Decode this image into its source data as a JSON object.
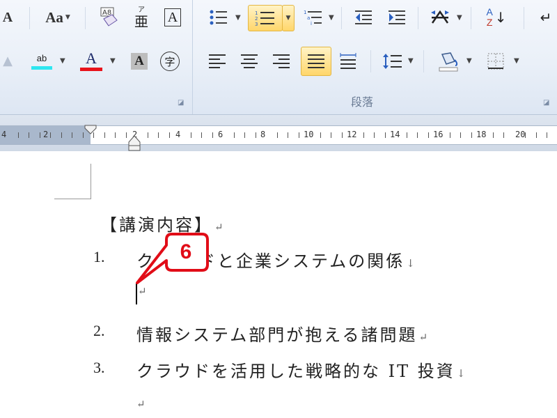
{
  "ribbon": {
    "font": {
      "font_size_label": "A",
      "change_case_label": "Aa",
      "clear_format_label": "Aₐ",
      "phonetic_top": "ア",
      "phonetic_bottom": "亜",
      "char_border_label": "A",
      "font_color_label": "A",
      "char_shading_label": "A",
      "enclose_char_label": "字",
      "highlight_label": "ab"
    },
    "paragraph": {
      "group_label": "段落",
      "sort_label_top": "A",
      "sort_label_bottom": "Z"
    },
    "colors": {
      "highlight": "#2ee6f0",
      "font_color": "#e8131b",
      "active_fill": "#ffd66b"
    }
  },
  "ruler": {
    "labels": [
      "4",
      "2",
      "2",
      "4",
      "6",
      "8",
      "10",
      "12",
      "14",
      "16",
      "18",
      "20"
    ]
  },
  "document": {
    "heading": "【講演内容】",
    "return_mark": "↵",
    "linebreak_mark": "↓",
    "items": [
      {
        "number": "1.",
        "text": "ク",
        "text_after": "ドと企業システムの関係",
        "end_mark": "↓"
      },
      {
        "number": "2.",
        "text": "情報システム部門が抱える諸問題",
        "end_mark": "↵"
      },
      {
        "number": "3.",
        "text": "クラウドを活用した戦略的な IT 投資",
        "end_mark": "↓"
      }
    ]
  },
  "callout": {
    "step_number": "6",
    "color": "#e10c17"
  }
}
